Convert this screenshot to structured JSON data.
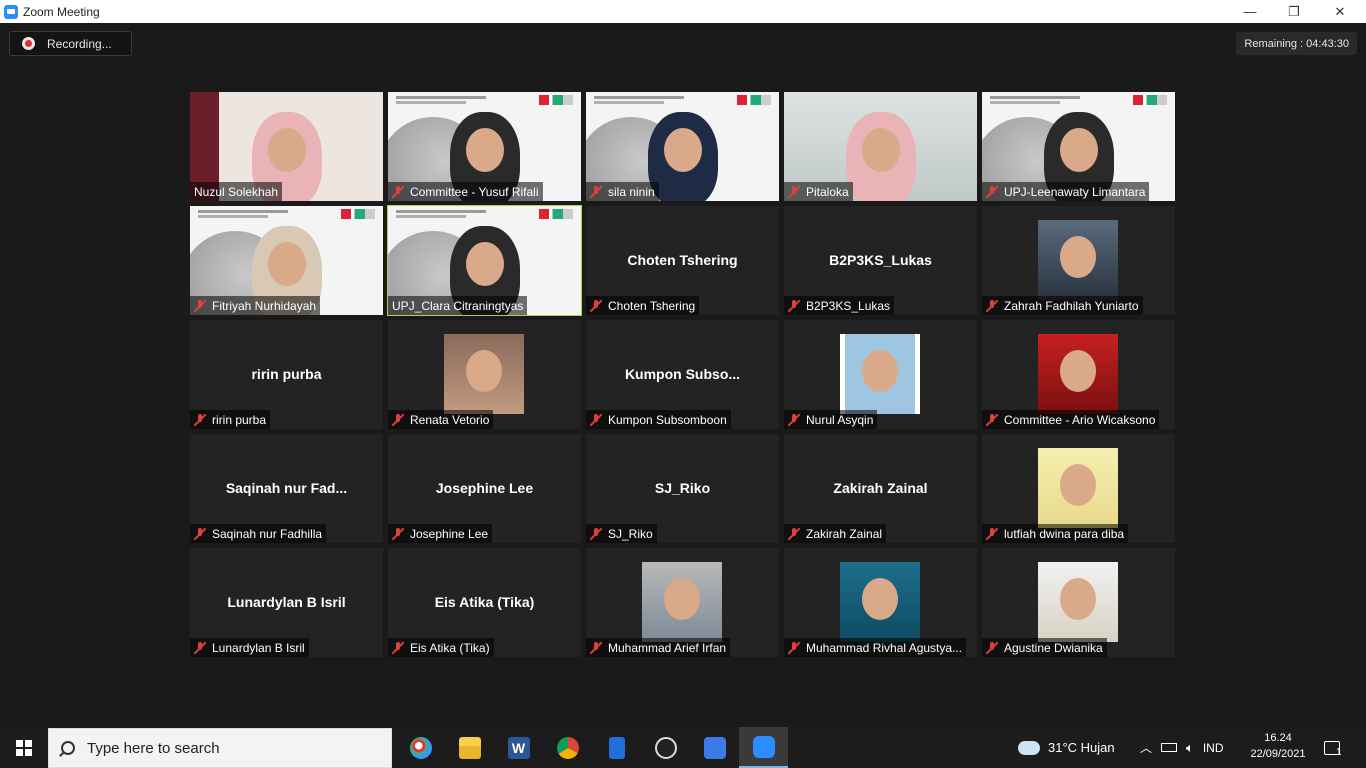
{
  "window": {
    "title": "Zoom Meeting",
    "minimize": "—",
    "maximize": "❐",
    "close": "✕"
  },
  "recording": {
    "label": "Recording..."
  },
  "remaining": {
    "text": "Remaining : 04:43:30"
  },
  "participants": [
    {
      "label": "Nuzul Solekhah",
      "muted": false,
      "kind": "video"
    },
    {
      "label": "Committee - Yusuf Rifali",
      "muted": true,
      "kind": "slide"
    },
    {
      "label": "sila ninin",
      "muted": true,
      "kind": "slide"
    },
    {
      "label": "Pitaloka",
      "muted": true,
      "kind": "video"
    },
    {
      "label": "UPJ-Leenawaty Limantara",
      "muted": true,
      "kind": "slide"
    },
    {
      "label": "Fitriyah Nurhidayah",
      "muted": true,
      "kind": "slide"
    },
    {
      "label": "UPJ_Clara Citraningtyas",
      "muted": false,
      "kind": "slide",
      "active": true
    },
    {
      "label": "Choten Tshering",
      "display": "Choten Tshering",
      "muted": true,
      "kind": "name"
    },
    {
      "label": "B2P3KS_Lukas",
      "display": "B2P3KS_Lukas",
      "muted": true,
      "kind": "name"
    },
    {
      "label": "Zahrah Fadhilah Yuniarto",
      "muted": true,
      "kind": "photo"
    },
    {
      "label": "ririn purba",
      "display": "ririn purba",
      "muted": true,
      "kind": "name"
    },
    {
      "label": "Renata Vetorio",
      "muted": true,
      "kind": "photo"
    },
    {
      "label": "Kumpon Subsomboon",
      "display": "Kumpon  Subso...",
      "muted": true,
      "kind": "name"
    },
    {
      "label": "Nurul Asyqin",
      "muted": true,
      "kind": "photo"
    },
    {
      "label": "Committee - Ario Wicaksono",
      "muted": true,
      "kind": "photo"
    },
    {
      "label": "Saqinah nur Fadhilla",
      "display": "Saqinah  nur  Fad...",
      "muted": true,
      "kind": "name"
    },
    {
      "label": "Josephine Lee",
      "display": "Josephine Lee",
      "muted": true,
      "kind": "name"
    },
    {
      "label": "SJ_Riko",
      "display": "SJ_Riko",
      "muted": true,
      "kind": "name"
    },
    {
      "label": "Zakirah Zainal",
      "display": "Zakirah Zainal",
      "muted": true,
      "kind": "name"
    },
    {
      "label": "lutfiah dwina para diba",
      "muted": true,
      "kind": "photo"
    },
    {
      "label": "Lunardylan B Isril",
      "display": "Lunardylan B Isril",
      "muted": true,
      "kind": "name"
    },
    {
      "label": "Eis Atika (Tika)",
      "display": "Eis Atika (Tika)",
      "muted": true,
      "kind": "name"
    },
    {
      "label": "Muhammad Arief Irfan",
      "muted": true,
      "kind": "photo"
    },
    {
      "label": "Muhammad Rivhal Agustya...",
      "muted": true,
      "kind": "photo"
    },
    {
      "label": "Agustine Dwianika",
      "muted": true,
      "kind": "photo"
    }
  ],
  "taskbar": {
    "search_placeholder": "Type here to search",
    "apps": [
      "paint-icon",
      "file-explorer-icon",
      "word-icon",
      "chrome-icon",
      "document-viewer-icon",
      "obs-icon",
      "vpn-icon",
      "zoom-icon"
    ],
    "weather": "31°C  Hujan",
    "language": "IND",
    "time": "16.24",
    "date": "22/09/2021",
    "notifications": "1"
  }
}
